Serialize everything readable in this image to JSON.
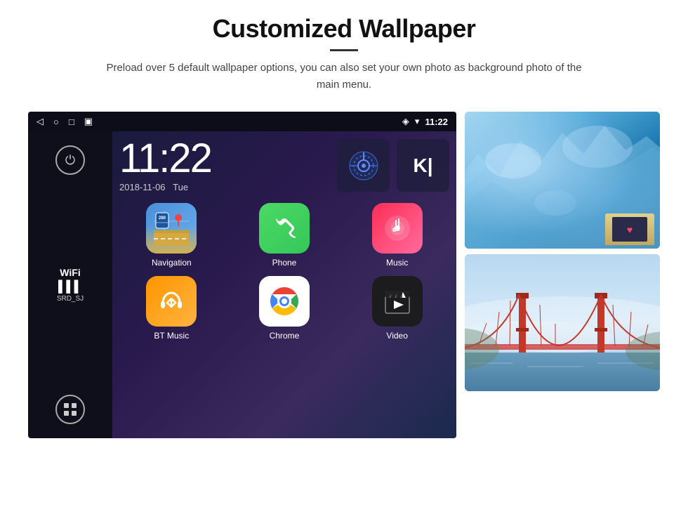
{
  "header": {
    "title": "Customized Wallpaper",
    "subtitle": "Preload over 5 default wallpaper options, you can also set your own photo as background photo of the main menu."
  },
  "device": {
    "status_bar": {
      "time": "11:22",
      "icons": [
        "back",
        "home",
        "recents",
        "screenshot"
      ],
      "right_icons": [
        "location",
        "wifi",
        "signal"
      ]
    },
    "clock": {
      "time": "11:22",
      "date": "2018-11-06",
      "day": "Tue"
    },
    "wifi": {
      "label": "WiFi",
      "signal": "▌▌▌",
      "network": "SRD_SJ"
    },
    "apps": [
      {
        "name": "Navigation",
        "type": "navigation"
      },
      {
        "name": "Phone",
        "type": "phone"
      },
      {
        "name": "Music",
        "type": "music"
      },
      {
        "name": "BT Music",
        "type": "btmusic"
      },
      {
        "name": "Chrome",
        "type": "chrome"
      },
      {
        "name": "Video",
        "type": "video"
      }
    ]
  },
  "wallpapers": [
    {
      "type": "ice",
      "alt": "Ice blue wallpaper"
    },
    {
      "type": "bridge",
      "alt": "Golden Gate Bridge wallpaper"
    }
  ],
  "labels": {
    "navigation_shield": "280",
    "power_symbol": "⏻",
    "apps_grid_symbol": "⊞"
  }
}
